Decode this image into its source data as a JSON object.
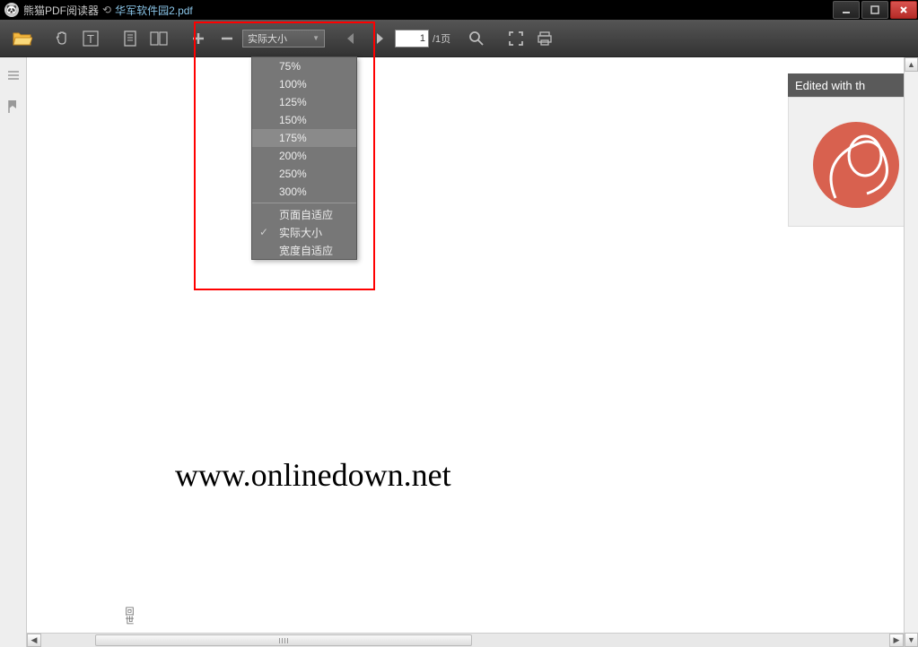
{
  "titlebar": {
    "app_name": "熊猫PDF阅读器",
    "document_name": "华军软件园2.pdf"
  },
  "toolbar": {
    "zoom_label": "实际大小",
    "page_current": "1",
    "page_total": "/1页"
  },
  "zoom_menu": {
    "items": [
      {
        "label": "75%",
        "checked": false,
        "hover": false
      },
      {
        "label": "100%",
        "checked": false,
        "hover": false
      },
      {
        "label": "125%",
        "checked": false,
        "hover": false
      },
      {
        "label": "150%",
        "checked": false,
        "hover": false
      },
      {
        "label": "175%",
        "checked": false,
        "hover": true
      },
      {
        "label": "200%",
        "checked": false,
        "hover": false
      },
      {
        "label": "250%",
        "checked": false,
        "hover": false
      },
      {
        "label": "300%",
        "checked": false,
        "hover": false
      }
    ],
    "fit_items": [
      {
        "label": "页面自适应",
        "checked": false
      },
      {
        "label": "实际大小",
        "checked": true
      },
      {
        "label": "宽度自适应",
        "checked": false
      }
    ]
  },
  "document": {
    "body_text": "www.onlinedown.net",
    "side_text": "回世"
  },
  "watermark": {
    "text": "Edited with th"
  }
}
